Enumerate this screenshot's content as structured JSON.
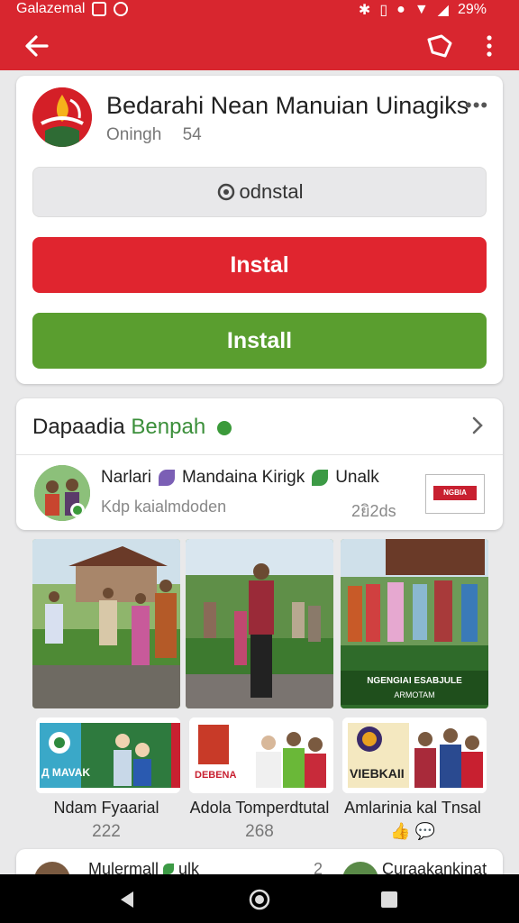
{
  "status_bar": {
    "carrier": "Galazemal",
    "battery": "29%"
  },
  "app": {
    "title": "Bedarahi Nean Manuian Uinagiks",
    "meta_left": "Oningh",
    "meta_right": "54",
    "uninstall_label": "odnstal",
    "install_red_label": "Instal",
    "install_green_label": "Install"
  },
  "section": {
    "title_part1": "Dapaadia",
    "title_part2": "Benpah",
    "row_name1": "Narlari",
    "row_name2": "Mandaina Kirigk",
    "row_name3": "Unalk",
    "row_sub": "Kdp kaialmdoden",
    "row_time": "2ยิ2ds",
    "badge_text": "NGBIA"
  },
  "gallery": {
    "photo3_banner": "NGENGIAI ESABJULE",
    "photo3_sub": "ARMOTAM",
    "items": [
      {
        "caption": "Ndam Fyaarial",
        "count": "222",
        "thumb_text": "Д MAVAK"
      },
      {
        "caption": "Adola Tomperdtutal",
        "count": "268",
        "thumb_text": "DEBENA"
      },
      {
        "caption": "Amlarinia kal Tnsal",
        "count": "",
        "thumb_text": "VIEBKAII"
      }
    ]
  },
  "bottom_row": {
    "text_left": "Mulermall",
    "text_left_suffix": "ulk",
    "num": "2",
    "text_right": "Curaakankinat"
  },
  "colors": {
    "brand_red": "#d8262f",
    "install_red": "#e0252f",
    "install_green": "#5a9e2f",
    "accent_green": "#3b8f3a"
  },
  "icons": [
    "back-arrow-icon",
    "share-icon",
    "overflow-menu-icon",
    "chevron-right-icon",
    "verified-icon",
    "leaf-icon",
    "like-icon",
    "nav-back-icon",
    "nav-home-icon",
    "nav-recents-icon"
  ]
}
